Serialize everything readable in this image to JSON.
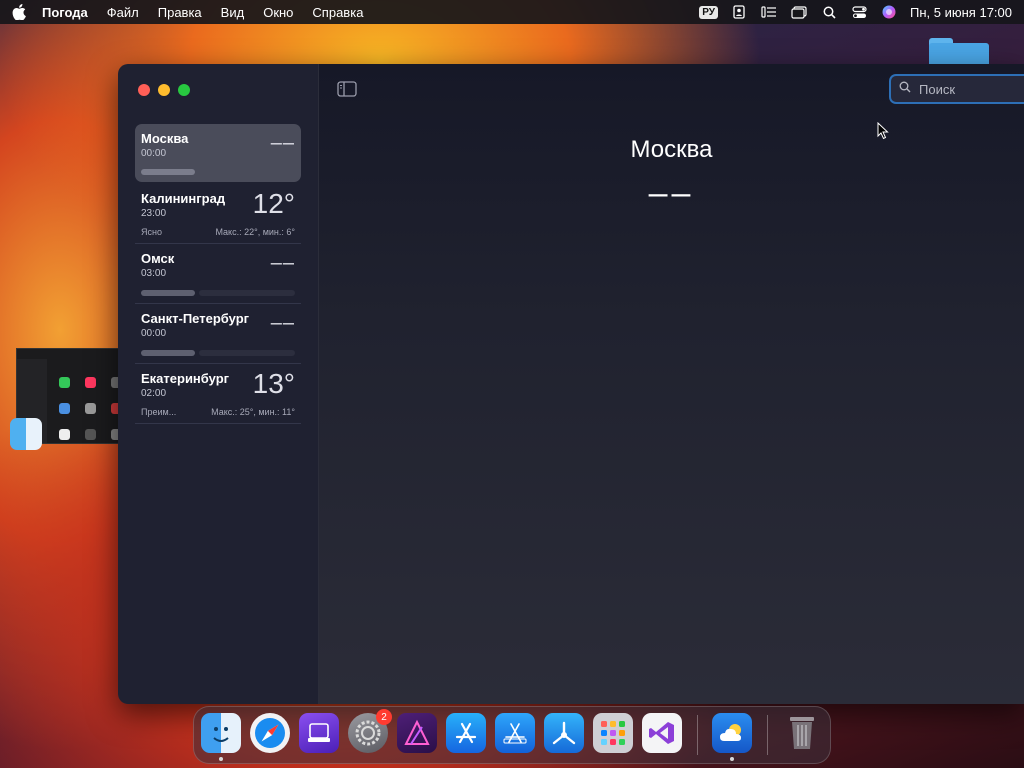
{
  "menubar": {
    "app_name": "Погода",
    "menus": [
      "Файл",
      "Правка",
      "Вид",
      "Окно",
      "Справка"
    ],
    "language": "РУ",
    "clock": "Пн, 5 июня  17:00"
  },
  "sidebar": {
    "cities": [
      {
        "name": "Москва",
        "time": "00:00",
        "temp": "––",
        "selected": true
      },
      {
        "name": "Калининград",
        "time": "23:00",
        "temp": "12°",
        "condition": "Ясно",
        "range": "Макс.: 22°, мин.: 6°"
      },
      {
        "name": "Омск",
        "time": "03:00",
        "temp": "––"
      },
      {
        "name": "Санкт-Петербург",
        "time": "00:00",
        "temp": "––"
      },
      {
        "name": "Екатеринбург",
        "time": "02:00",
        "temp": "13°",
        "condition": "Преим...",
        "range": "Макс.: 25°, мин.: 11°"
      }
    ]
  },
  "main": {
    "city": "Москва",
    "temp": "––",
    "search_placeholder": "Поиск"
  },
  "dock": {
    "apps": [
      "finder-icon",
      "safari-icon",
      "media-icon",
      "system-settings-icon",
      "affinity-icon",
      "app-store-icon",
      "xcode-icon",
      "instruments-icon",
      "launchpad-icon",
      "visual-studio-icon",
      "weather-icon",
      "trash-icon"
    ],
    "settings_badge": "2"
  },
  "colors": {
    "accent": "#2d6fb6",
    "sidebar_bg": "#1f2131",
    "main_bg": "#20222f"
  }
}
